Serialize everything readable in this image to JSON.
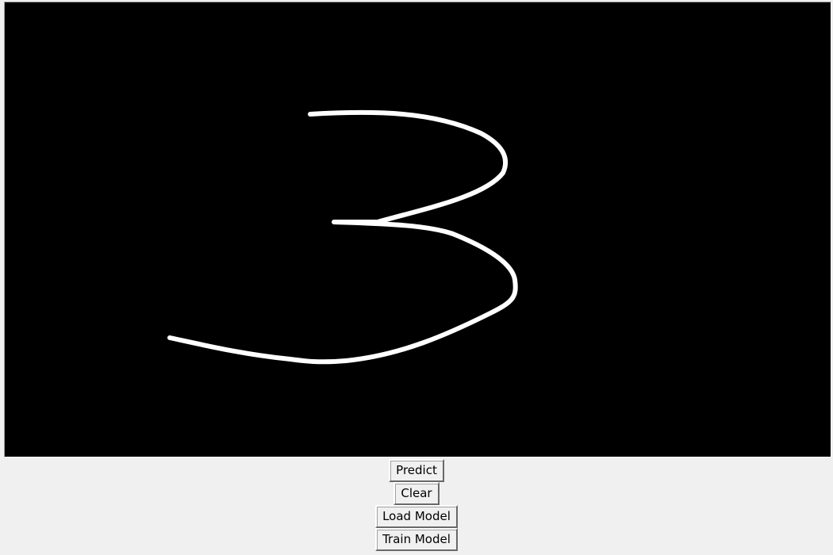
{
  "canvas": {
    "background_color": "#000000",
    "stroke_color": "#ffffff",
    "drawn_digit": "3"
  },
  "buttons": {
    "predict": "Predict",
    "clear": "Clear",
    "load_model": "Load Model",
    "train_model": "Train Model"
  }
}
